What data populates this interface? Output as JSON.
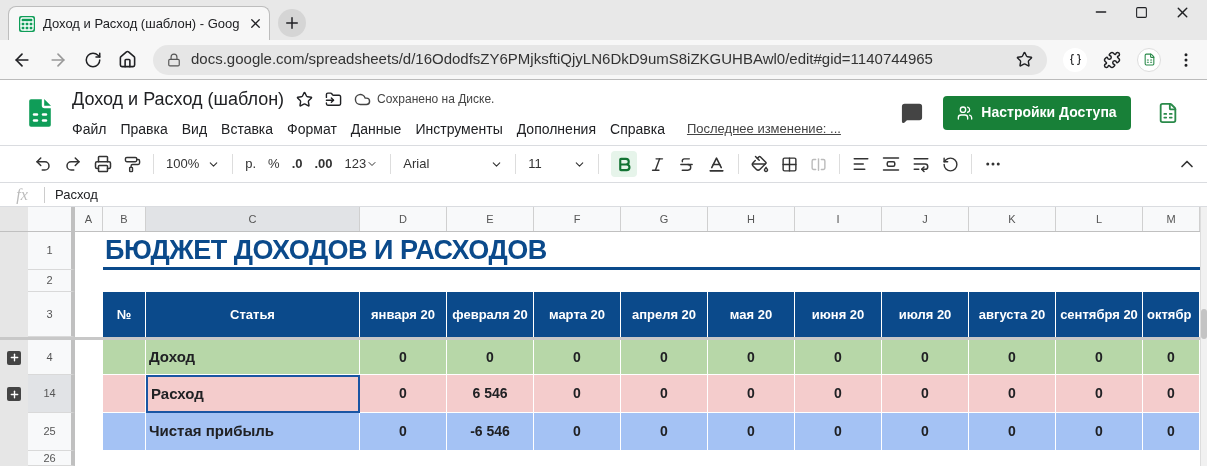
{
  "browser": {
    "tab_title": "Доход и Расход (шаблон) - Goog",
    "url": "docs.google.com/spreadsheets/d/16OdodfsZY6PMjksftiQjyLN6DkD9umS8iZKGUHBAwl0/edit#gid=1140744965"
  },
  "app": {
    "title": "Доход и Расход (шаблон)",
    "status": "Сохранено на Диске.",
    "menu": [
      "Файл",
      "Правка",
      "Вид",
      "Вставка",
      "Формат",
      "Данные",
      "Инструменты",
      "Дополнения",
      "Справка"
    ],
    "last_edit": "Последнее изменение: ...",
    "share_button": "Настройки Доступа"
  },
  "toolbar": {
    "zoom": "100%",
    "currency": "р.",
    "percent": "%",
    "decrease_decimals": ".0",
    "increase_decimals": ".00",
    "number_format": "123",
    "font": "Arial",
    "font_size": "11",
    "bold": true
  },
  "formula_bar": {
    "function_label": "fx",
    "value": "Расход"
  },
  "sheet": {
    "columns": [
      {
        "label": "A",
        "selected": false
      },
      {
        "label": "B",
        "selected": false
      },
      {
        "label": "C",
        "selected": true
      },
      {
        "label": "D",
        "selected": false
      },
      {
        "label": "E",
        "selected": false
      },
      {
        "label": "F",
        "selected": false
      },
      {
        "label": "G",
        "selected": false
      },
      {
        "label": "H",
        "selected": false
      },
      {
        "label": "I",
        "selected": false
      },
      {
        "label": "J",
        "selected": false
      },
      {
        "label": "K",
        "selected": false
      },
      {
        "label": "L",
        "selected": false
      },
      {
        "label": "M",
        "selected": false
      }
    ],
    "title_row": {
      "number": "1",
      "title": "БЮДЖЕТ ДОХОДОВ И РАСХОДОВ"
    },
    "spacer_row": {
      "number": "2"
    },
    "header_row": {
      "number": "3",
      "cells": [
        "№",
        "Статья",
        "января 20",
        "февраля 20",
        "марта 20",
        "апреля 20",
        "мая 20",
        "июня 20",
        "июля 20",
        "августа 20",
        "сентября 20",
        "октябр"
      ]
    },
    "data_rows": [
      {
        "number": "4",
        "collapsed_group": true,
        "color": "#b7d7a8",
        "label": "Доход",
        "label_selected": false,
        "row_selected": false,
        "values": [
          "0",
          "0",
          "0",
          "0",
          "0",
          "0",
          "0",
          "0",
          "0",
          "0"
        ]
      },
      {
        "number": "14",
        "collapsed_group": true,
        "color": "#f4cccc",
        "label": "Расход",
        "label_selected": true,
        "row_selected": true,
        "values": [
          "0",
          "6 546",
          "0",
          "0",
          "0",
          "0",
          "0",
          "0",
          "0",
          "0"
        ]
      },
      {
        "number": "25",
        "collapsed_group": false,
        "color": "#a4c2f4",
        "label": "Чистая прибыль",
        "label_selected": false,
        "row_selected": false,
        "values": [
          "0",
          "-6 546",
          "0",
          "0",
          "0",
          "0",
          "0",
          "0",
          "0",
          "0"
        ]
      }
    ],
    "last_row": {
      "number": "26"
    }
  }
}
